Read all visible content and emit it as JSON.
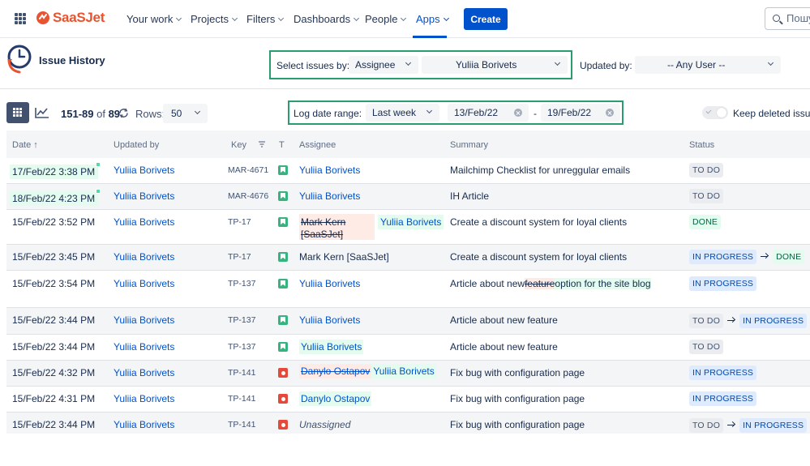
{
  "nav": {
    "brand": "SaaSJet",
    "items": [
      {
        "label": "Your work"
      },
      {
        "label": "Projects"
      },
      {
        "label": "Filters"
      },
      {
        "label": "Dashboards"
      },
      {
        "label": "People"
      },
      {
        "label": "Apps"
      }
    ],
    "active_item": "Apps",
    "create_label": "Create",
    "search_placeholder": "Пошук"
  },
  "app": {
    "title": "Issue History",
    "select_issues_label": "Select issues by:",
    "select_issues_value": "Assignee",
    "assignee_value": "Yuliia Borivets",
    "updated_by_label": "Updated by:",
    "updated_by_value": "-- Any User --",
    "log_range_label": "Log date range:",
    "log_range_value": "Last week",
    "date_from": "13/Feb/22",
    "date_separator": "-",
    "date_to": "19/Feb/22",
    "counter_range": "151-89",
    "counter_of": "of",
    "counter_total": "89",
    "rows_label": "Rows:",
    "rows_value": "50",
    "keep_deleted_label": "Keep deleted issues"
  },
  "table": {
    "headers": {
      "date": "Date ↑",
      "updated_by": "Updated by",
      "key": "Key",
      "type": "T",
      "assignee": "Assignee",
      "summary": "Summary",
      "status": "Status"
    },
    "rows": [
      {
        "date": "17/Feb/22 3:38 PM",
        "updated_by": "Yuliia Borivets",
        "key": "MAR-4671",
        "assignee": "Yuliia Borivets",
        "summary": "Mailchimp Checklist for unreggular emails",
        "status_from": "TO DO"
      },
      {
        "date": "18/Feb/22 4:23 PM",
        "updated_by": "Yuliia Borivets",
        "key": "MAR-4676",
        "assignee": "Yuliia Borivets",
        "summary": "IH Article",
        "status_from": "TO DO"
      },
      {
        "date": "15/Feb/22 3:52 PM",
        "updated_by": "Yuliia Borivets",
        "key": "TP-17",
        "assignee_old_line1": "Mark Kern",
        "assignee_old_line2": "[SaaSJet]",
        "assignee_new": "Yuliia Borivets",
        "summary": "Create a discount system for loyal clients",
        "status_from": "DONE"
      },
      {
        "date": "15/Feb/22 3:45 PM",
        "updated_by": "Yuliia Borivets",
        "key": "TP-17",
        "assignee": "Mark Kern [SaaSJet]",
        "summary": "Create a discount system for loyal clients",
        "status_from": "IN PROGRESS",
        "status_to": "DONE"
      },
      {
        "date": "15/Feb/22 3:54 PM",
        "updated_by": "Yuliia Borivets",
        "key": "TP-137",
        "assignee": "Yuliia Borivets",
        "summary_prefix": "Article about new",
        "summary_deleted": "feature",
        "summary_inserted": "option for the site blog",
        "status_from": "IN PROGRESS"
      },
      {
        "date": "15/Feb/22 3:44 PM",
        "updated_by": "Yuliia Borivets",
        "key": "TP-137",
        "assignee": "Yuliia Borivets",
        "summary": "Article about new feature",
        "status_from": "TO DO",
        "status_to": "IN PROGRESS"
      },
      {
        "date": "15/Feb/22 3:44 PM",
        "updated_by": "Yuliia Borivets",
        "key": "TP-137",
        "assignee_new": "Yuliia Borivets",
        "summary": "Article about new feature",
        "status_from": "TO DO"
      },
      {
        "date": "15/Feb/22 4:32 PM",
        "updated_by": "Yuliia Borivets",
        "key": "TP-141",
        "assignee_old": "Danylo Ostapov",
        "assignee_new": "Yuliia Borivets",
        "summary": "Fix bug with configuration page",
        "status_from": "IN PROGRESS"
      },
      {
        "date": "15/Feb/22 4:31 PM",
        "updated_by": "Yuliia Borivets",
        "key": "TP-141",
        "assignee_new": "Danylo Ostapov",
        "summary": "Fix bug with configuration page",
        "status_from": "IN PROGRESS"
      },
      {
        "date": "15/Feb/22 3:44 PM",
        "updated_by": "Yuliia Borivets",
        "key": "TP-141",
        "assignee": "Unassigned",
        "summary": "Fix bug with configuration page",
        "status_from": "TO DO",
        "status_to": "IN PROGRESS"
      }
    ]
  },
  "colors": {
    "accent": "#0052cc",
    "brand": "#e8542f",
    "highlight_box": "#2a9d6f",
    "status_todo": "#ebecf0",
    "status_in_progress": "#deebff",
    "status_done": "#e3fcef"
  }
}
